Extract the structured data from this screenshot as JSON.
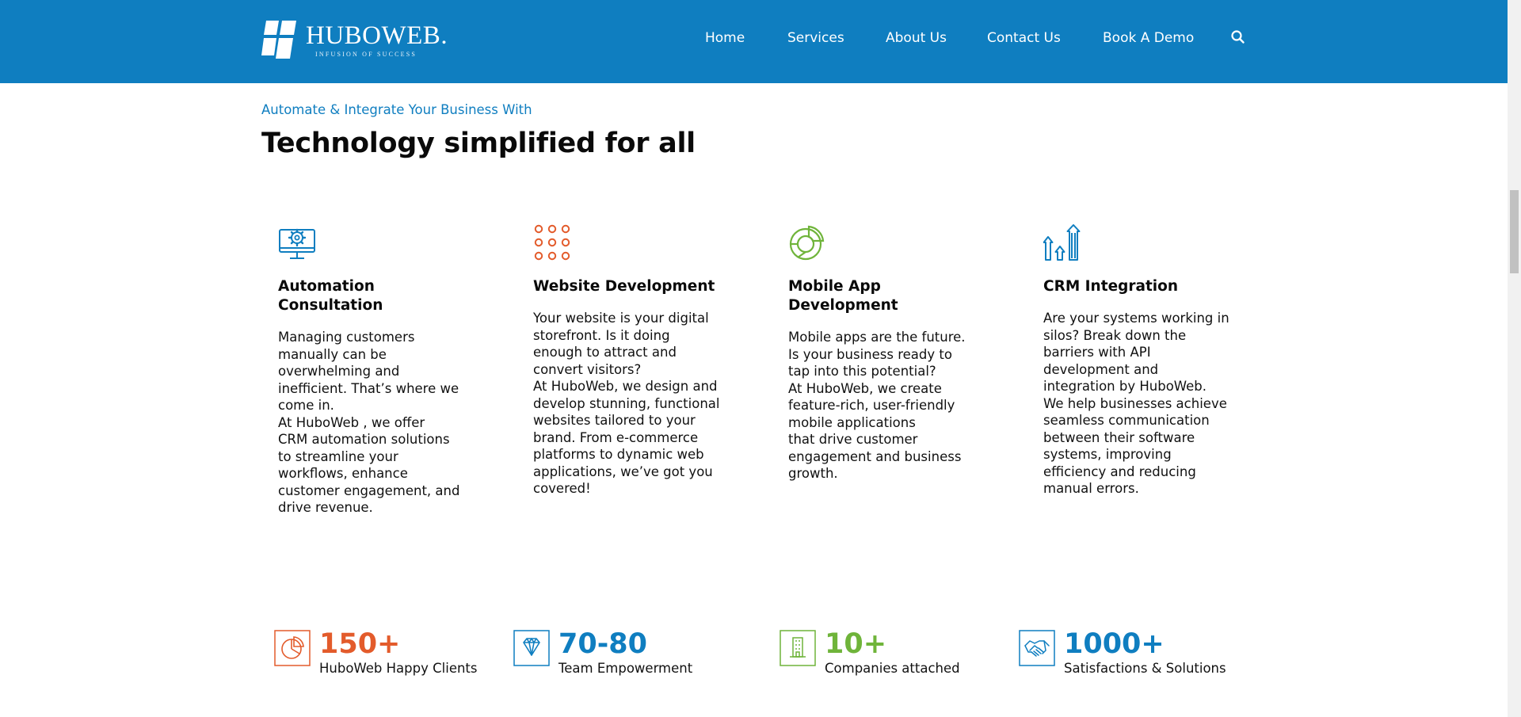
{
  "brand": {
    "name": "HUBOWEB.",
    "tagline": "INFUSION OF SUCCESS"
  },
  "nav": {
    "items": [
      {
        "label": "Home"
      },
      {
        "label": "Services"
      },
      {
        "label": "About Us"
      },
      {
        "label": "Contact Us"
      },
      {
        "label": "Book A Demo"
      }
    ],
    "search_icon": "search-icon"
  },
  "hero": {
    "eyebrow": "Automate & Integrate Your Business With",
    "headline": "Technology simplified for all"
  },
  "services": [
    {
      "icon": "monitor-gear-icon",
      "title_lines": [
        "Automation",
        "Consultation"
      ],
      "body_lines": [
        "Managing customers",
        "manually can be",
        "overwhelming and",
        "inefficient. That’s where we",
        "come in.",
        "At HuboWeb , we offer",
        "CRM automation solutions",
        "to streamline your",
        "workflows, enhance",
        "customer engagement, and",
        "drive revenue."
      ]
    },
    {
      "icon": "dot-grid-icon",
      "title_lines": [
        "Website Development"
      ],
      "body_lines": [
        "Your website is your digital",
        "storefront. Is it doing",
        "enough to attract and",
        "convert visitors?",
        "At HuboWeb, we design and",
        "develop stunning, functional",
        "websites tailored to your",
        "brand. From e-commerce",
        "platforms to dynamic web",
        "applications, we’ve got you",
        "covered!"
      ]
    },
    {
      "icon": "pie-chart-icon",
      "title_lines": [
        "Mobile App",
        "Development"
      ],
      "body_lines": [
        "Mobile apps are the future.",
        "Is your business ready to",
        "tap into this potential?",
        "At HuboWeb, we create",
        "feature-rich, user-friendly",
        "mobile applications",
        "that drive customer",
        "engagement and business",
        "growth."
      ]
    },
    {
      "icon": "growth-arrows-icon",
      "title_lines": [
        "CRM Integration"
      ],
      "body_lines": [
        "Are your systems working in",
        "silos? Break down the",
        "barriers with API",
        "development and",
        "integration by HuboWeb.",
        "We help businesses achieve",
        "seamless communication",
        "between their software",
        "systems, improving",
        "efficiency and reducing",
        "manual errors."
      ]
    }
  ],
  "stats": [
    {
      "icon": "pie-chart-box-icon",
      "value": "150+",
      "label": "HuboWeb Happy Clients",
      "color": "#e35b2b"
    },
    {
      "icon": "diamond-box-icon",
      "value": "70-80",
      "label": "Team Empowerment",
      "color": "#0f7ec0"
    },
    {
      "icon": "building-box-icon",
      "value": "10+",
      "label": "Companies attached",
      "color": "#6fb43a"
    },
    {
      "icon": "handshake-box-icon",
      "value": "1000+",
      "label": "Satisfactions & Solutions",
      "color": "#0f7ec0"
    }
  ],
  "colors": {
    "header_bg": "#0f7ec0",
    "accent_blue": "#0f7ec0",
    "accent_orange": "#e35b2b",
    "accent_green": "#6fb43a"
  }
}
